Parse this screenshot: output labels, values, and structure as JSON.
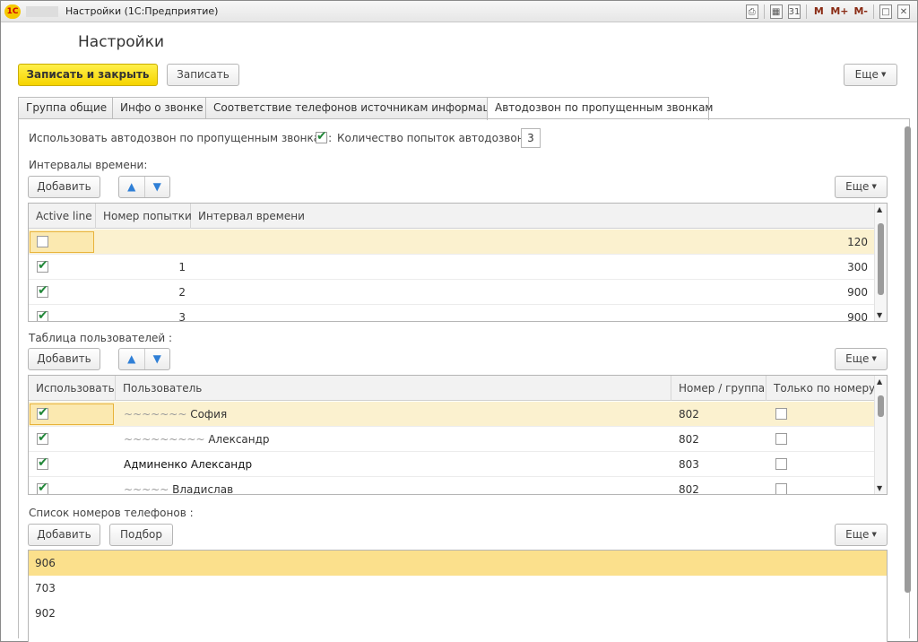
{
  "window": {
    "title": "Настройки  (1С:Предприятие)",
    "logo": "1С",
    "toolbar_icons": [
      "print-icon",
      "calculator-icon",
      "calendar-icon"
    ],
    "m_buttons": [
      "M",
      "M+",
      "M-"
    ],
    "controls": [
      "restore-icon",
      "close-icon"
    ]
  },
  "page": {
    "title": "Настройки"
  },
  "actions": {
    "save_close": "Записать и закрыть",
    "save": "Записать",
    "more": "Еще"
  },
  "tabs": [
    {
      "label": "Группа общие",
      "active": false
    },
    {
      "label": "Инфо о звонке",
      "active": false
    },
    {
      "label": "Соответствие телефонов источникам информации",
      "active": false
    },
    {
      "label": "Автодозвон по пропущенным звонкам",
      "active": true
    }
  ],
  "autodial": {
    "use_label": "Использовать автодозвон по пропущенным звонкам:",
    "use_checked": true,
    "attempts_label": "Количество попыток автодозвона:",
    "attempts_value": "3"
  },
  "intervals": {
    "section_label": "Интервалы времени:",
    "add_label": "Добавить",
    "more_label": "Еще",
    "columns": [
      "Active line",
      "Номер попытки",
      "Интервал времени"
    ],
    "rows": [
      {
        "active": false,
        "attempt": "",
        "interval": "120"
      },
      {
        "active": true,
        "attempt": "1",
        "interval": "300"
      },
      {
        "active": true,
        "attempt": "2",
        "interval": "900"
      },
      {
        "active": true,
        "attempt": "3",
        "interval": "900"
      }
    ]
  },
  "users": {
    "section_label": "Таблица пользователей :",
    "add_label": "Добавить",
    "more_label": "Еще",
    "columns": [
      "Использовать",
      "Пользователь",
      "Номер / группа",
      "Только по номеру"
    ],
    "rows": [
      {
        "use": true,
        "user": "София",
        "number": "802",
        "only": false
      },
      {
        "use": true,
        "user": "Александр",
        "number": "802",
        "only": false
      },
      {
        "use": true,
        "user": "Админенко Александр",
        "number": "803",
        "only": false
      },
      {
        "use": true,
        "user": "Владислав",
        "number": "802",
        "only": false
      }
    ]
  },
  "phones": {
    "section_label": "Список номеров телефонов :",
    "add_label": "Добавить",
    "pick_label": "Подбор",
    "more_label": "Еще",
    "rows": [
      "906",
      "703",
      "902"
    ]
  }
}
